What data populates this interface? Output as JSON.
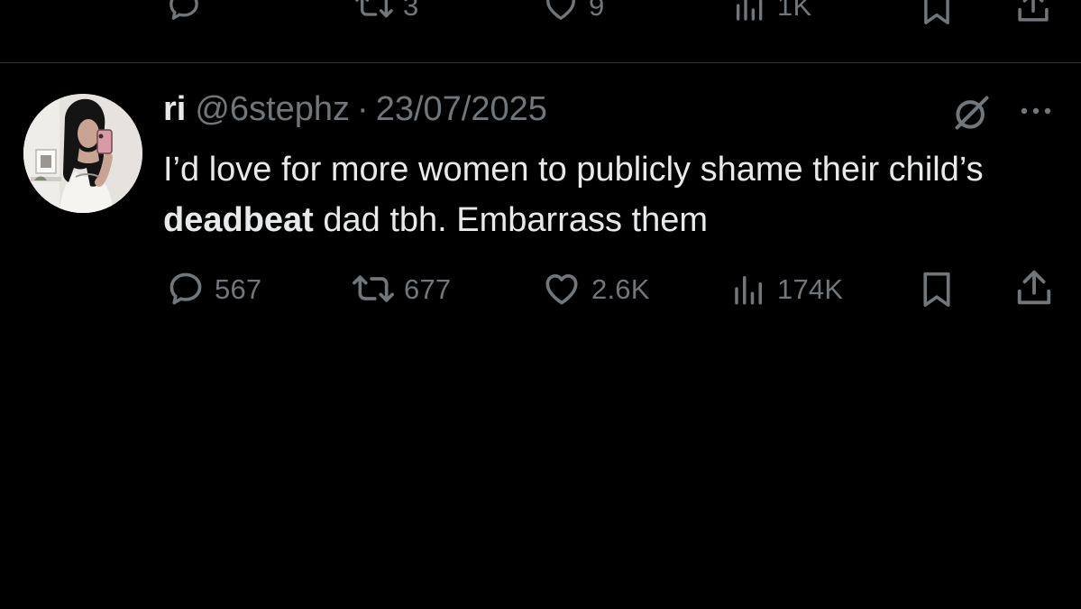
{
  "previous_tweet": {
    "actions": {
      "reply_count": "",
      "retweet_count": "3",
      "like_count": "9",
      "view_count": "1K"
    }
  },
  "tweet": {
    "display_name": "ri",
    "handle": "@6stephz",
    "separator": "·",
    "date": "23/07/2025",
    "text_part1": "I’d love for more women to publicly shame their child’s ",
    "text_bold": "deadbeat",
    "text_part2": " dad tbh. Embarrass them",
    "actions": {
      "reply_count": "567",
      "retweet_count": "677",
      "like_count": "2.6K",
      "view_count": "174K"
    }
  },
  "icons": {
    "reply": "reply-icon",
    "retweet": "retweet-icon",
    "like": "like-icon",
    "views": "views-icon",
    "bookmark": "bookmark-icon",
    "share": "share-icon",
    "grok": "grok-icon",
    "more": "more-icon"
  },
  "colors": {
    "background": "#000000",
    "text_primary": "#e7e9ea",
    "text_secondary": "#71767b",
    "divider": "#2f3336"
  }
}
